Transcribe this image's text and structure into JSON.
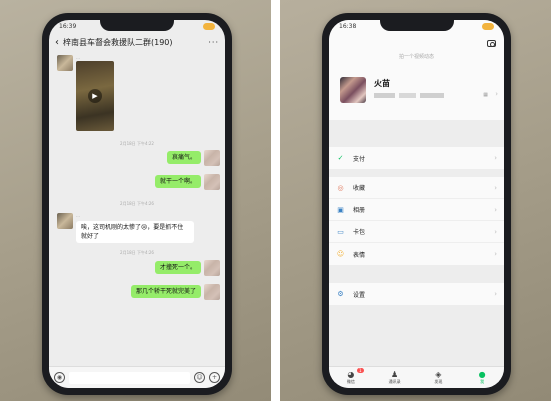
{
  "left": {
    "status": {
      "time": "16:39"
    },
    "header": {
      "back": "‹",
      "title": "梓南县车督会救援队二群(190)",
      "more": "···"
    },
    "messages": {
      "sender1": "…",
      "time1": "2月18日 下午4:22",
      "bubble1": "哀痛气。",
      "bubble2": "就干一个啊。",
      "time2": "2月18日 下午4:26",
      "sender2": "…",
      "bubble3": "唉，这司机刚的太惨了😢，要是抓不住就好了",
      "time3": "2月18日 下午4:26",
      "bubble4": "才撞死一个。",
      "bubble5": "那几个轿干死就完美了"
    },
    "inputbar": {
      "voice": "◉",
      "emoji": "☺",
      "plus": "+"
    }
  },
  "right": {
    "status": {
      "time": "16:38"
    },
    "story": "拍一个视频动态",
    "profile": {
      "name": "火苗",
      "arrow": "›"
    },
    "menu": [
      {
        "icon": "✓",
        "label": "支付"
      },
      {
        "icon": "◎",
        "label": "收藏"
      },
      {
        "icon": "▣",
        "label": "相册"
      },
      {
        "icon": "▭",
        "label": "卡包"
      },
      {
        "icon": "☺",
        "label": "表情"
      },
      {
        "icon": "⚙",
        "label": "设置"
      }
    ],
    "tabs": [
      {
        "icon": "◕",
        "label": "微信",
        "badge": "1"
      },
      {
        "icon": "♟",
        "label": "通讯录"
      },
      {
        "icon": "◈",
        "label": "发现"
      },
      {
        "icon": "●",
        "label": "我"
      }
    ]
  }
}
